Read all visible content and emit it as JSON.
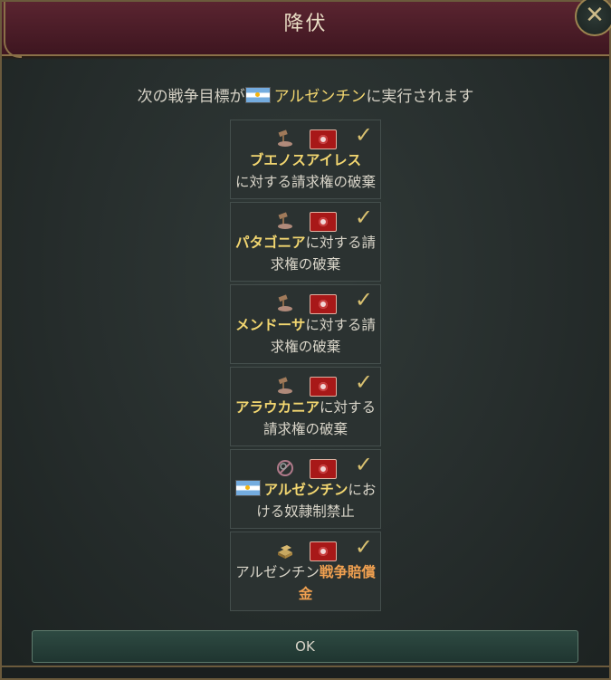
{
  "dialog": {
    "title": "降伏",
    "close_label": "✕",
    "subtitle_prefix": "次の戦争目標が",
    "subtitle_country": "アルゼンチン",
    "subtitle_suffix": "に実行されます",
    "ok_label": "OK"
  },
  "goals": [
    {
      "icon": "gavel-icon",
      "highlight": "ブエノスアイレス",
      "rest": "に対する請求権の破棄"
    },
    {
      "icon": "gavel-icon",
      "highlight": "パタゴニア",
      "rest": "に対する請求権の破棄"
    },
    {
      "icon": "gavel-icon",
      "highlight": "メンドーサ",
      "rest": "に対する請求権の破棄"
    },
    {
      "icon": "gavel-icon",
      "highlight": "アラウカニア",
      "rest": "に対する請求権の破棄"
    },
    {
      "icon": "broken-chain-icon",
      "highlight": "アルゼンチン",
      "rest": "における奴隷制禁止"
    },
    {
      "icon": "gold-bars-icon",
      "prefix": "アルゼンチン",
      "highlight": "戦争賠償金"
    }
  ]
}
